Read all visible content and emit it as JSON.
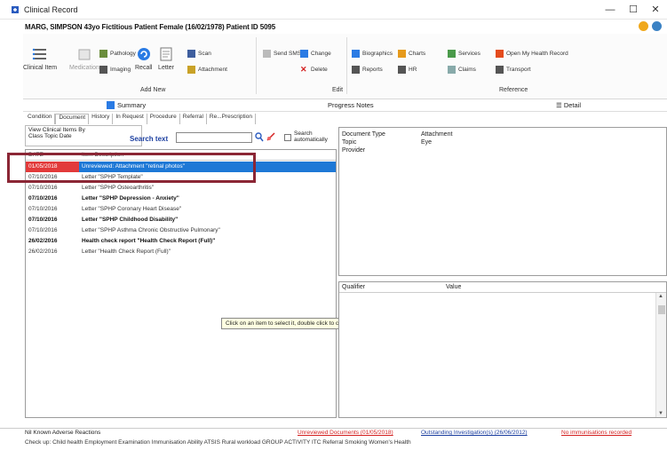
{
  "window": {
    "title": "Clinical Record",
    "minimize": "—",
    "maximize": "☐",
    "close": "✕"
  },
  "patient_bar": "MARG, SIMPSON 43yo Fictitious Patient Female (16/02/1978) Patient ID 5095",
  "ribbon": {
    "clinical_item": "Clinical Item",
    "medication": "Medication",
    "pathology": "Pathology",
    "imaging": "Imaging",
    "recall": "Recall",
    "letter": "Letter",
    "scan": "Scan",
    "attachment": "Attachment",
    "send_sms": "Send SMS",
    "change": "Change",
    "delete": "Delete",
    "biographics": "Biographics",
    "reports": "Reports",
    "hr": "HR",
    "charts": "Charts",
    "services": "Services",
    "claims": "Claims",
    "open_health_record": "Open My Health Record",
    "transport": "Transport",
    "group_add_new": "Add New",
    "group_edit": "Edit",
    "group_reference": "Reference"
  },
  "summary_row": {
    "summary": "Summary",
    "progress_notes": "Progress Notes",
    "detail": "Detail"
  },
  "tabs": [
    "Condition",
    "Document",
    "History",
    "In Request",
    "Procedure",
    "Referral",
    "Re...Prescription"
  ],
  "filter": {
    "title": "View Clinical Items By",
    "options": "Class  Topic  Date",
    "search_label": "Search text",
    "search_value": "",
    "auto_label_1": "Search",
    "auto_label_2": "automatically"
  },
  "list": {
    "columns": [
      "DATE",
      "Item Description"
    ],
    "rows": [
      {
        "date": "01/05/2018",
        "text": "Unreviewed: Attachment \"retinal photos\"",
        "style": "selected"
      },
      {
        "date": "07/10/2016",
        "text": "Letter \"SPHP Template\"",
        "style": "normal"
      },
      {
        "date": "07/10/2016",
        "text": "Letter \"SPHP Osteoarthritis\"",
        "style": "normal"
      },
      {
        "date": "07/10/2016",
        "text": "Letter \"SPHP Depression - Anxiety\"",
        "style": "bold"
      },
      {
        "date": "07/10/2016",
        "text": "Letter \"SPHP Coronary Heart Disease\"",
        "style": "normal"
      },
      {
        "date": "07/10/2016",
        "text": "Letter \"SPHP Childhood Disability\"",
        "style": "bold"
      },
      {
        "date": "07/10/2016",
        "text": "Letter \"SPHP Asthma Chronic Obstructive Pulmonary\"",
        "style": "normal"
      },
      {
        "date": "26/02/2016",
        "text": "Health check report \"Health Check Report (Full)\"",
        "style": "bold"
      },
      {
        "date": "26/02/2016",
        "text": "Letter \"Health Check Report (Full)\"",
        "style": "normal"
      }
    ]
  },
  "tooltip": "Click on an item to select it, double click to change it.",
  "detail": {
    "document_type_label": "Document Type",
    "document_type_value": "Attachment",
    "topic_label": "Topic",
    "topic_value": "Eye",
    "provider_label": "Provider",
    "qualifier_col": "Qualifier",
    "value_col": "Value"
  },
  "status": {
    "adverse": "Nil Known Adverse Reactions",
    "unreviewed": "Unreviewed Documents (01/05/2018)",
    "outstanding": "Outstanding Investigation(s) (26/06/2012)",
    "immunisations": "No immunisations recorded"
  },
  "bottom_links": "Check up:  Child health   Employment   Examination   Immunisation   Ability   ATSIS   Rural workload   GROUP ACTIVITY   ITC   Referral   Smoking   Women's Health",
  "colors": {
    "selected_row": "#1e78d6",
    "date_flag": "#e23a3a",
    "highlight_box": "#8b2635",
    "link_blue": "#1c3fa0",
    "alert_red": "#d42020"
  }
}
